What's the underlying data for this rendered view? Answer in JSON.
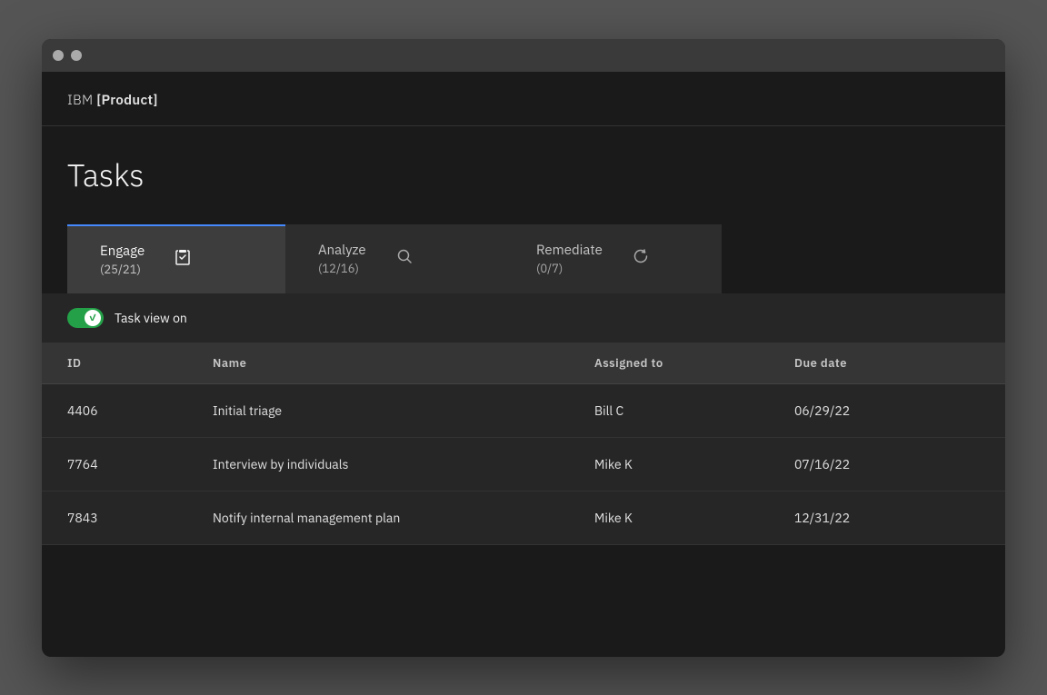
{
  "window": {
    "title_bar": {
      "dots": [
        "dot1",
        "dot2"
      ]
    }
  },
  "header": {
    "brand_prefix": "IBM ",
    "brand_product": "[Product]"
  },
  "page": {
    "title": "Tasks"
  },
  "tabs": [
    {
      "id": "engage",
      "name": "Engage",
      "count": "(25/21)",
      "icon": "📋",
      "active": true
    },
    {
      "id": "analyze",
      "name": "Analyze",
      "count": "(12/16)",
      "icon": "🔍",
      "active": false
    },
    {
      "id": "remediate",
      "name": "Remediate",
      "count": "(0/7)",
      "icon": "🔄",
      "active": false
    }
  ],
  "task_view": {
    "toggle_label": "Task view on",
    "toggle_on": true
  },
  "table": {
    "columns": [
      {
        "key": "id",
        "label": "ID"
      },
      {
        "key": "name",
        "label": "Name"
      },
      {
        "key": "assigned_to",
        "label": "Assigned to"
      },
      {
        "key": "due_date",
        "label": "Due date"
      }
    ],
    "rows": [
      {
        "id": "4406",
        "name": "Initial triage",
        "assigned_to": "Bill C",
        "due_date": "06/29/22"
      },
      {
        "id": "7764",
        "name": "Interview by individuals",
        "assigned_to": "Mike K",
        "due_date": "07/16/22"
      },
      {
        "id": "7843",
        "name": "Notify internal management plan",
        "assigned_to": "Mike K",
        "due_date": "12/31/22"
      }
    ]
  }
}
